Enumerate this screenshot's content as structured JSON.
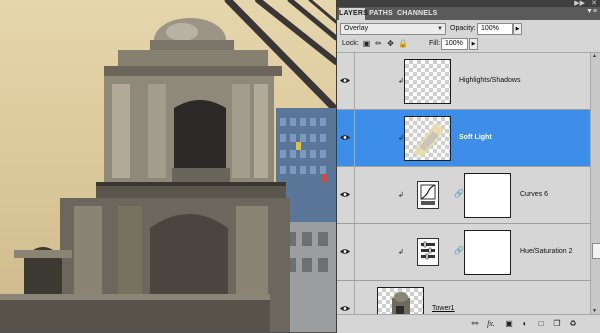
{
  "panel": {
    "collapse_icon": "collapse-arrows-icon",
    "close_icon": "close-icon",
    "menu_icon": "panel-menu-icon",
    "tabs": [
      {
        "label": "LAYERS",
        "active": true
      },
      {
        "label": "PATHS",
        "active": false
      },
      {
        "label": "CHANNELS",
        "active": false
      }
    ]
  },
  "options": {
    "blend_mode": "Overlay",
    "opacity_label": "Opacity:",
    "opacity_value": "100%",
    "lock_label": "Lock:",
    "fill_label": "Fill:",
    "fill_value": "100%"
  },
  "layers": [
    {
      "name": "Highlights/Shadows",
      "type": "pixel",
      "clipped": true,
      "selected": false,
      "visible": true
    },
    {
      "name": "Soft Light",
      "type": "pixel",
      "clipped": true,
      "selected": true,
      "visible": true
    },
    {
      "name": "Curves 6",
      "type": "adjustment-curves",
      "clipped": true,
      "selected": false,
      "visible": true
    },
    {
      "name": "Hue/Saturation 2",
      "type": "adjustment-hue-saturation",
      "clipped": true,
      "selected": false,
      "visible": true
    },
    {
      "name": "Tower1",
      "type": "pixel",
      "clipped": false,
      "selected": false,
      "visible": true
    }
  ],
  "colors": {
    "selection": "#3d8ee8",
    "panel_bg": "#d6d6d6",
    "sky": "#e0cfa2"
  },
  "footer_icons": [
    "link-layers-icon",
    "fx-icon",
    "add-mask-icon",
    "adjustment-layer-icon",
    "new-group-icon",
    "new-layer-icon",
    "trash-icon"
  ]
}
